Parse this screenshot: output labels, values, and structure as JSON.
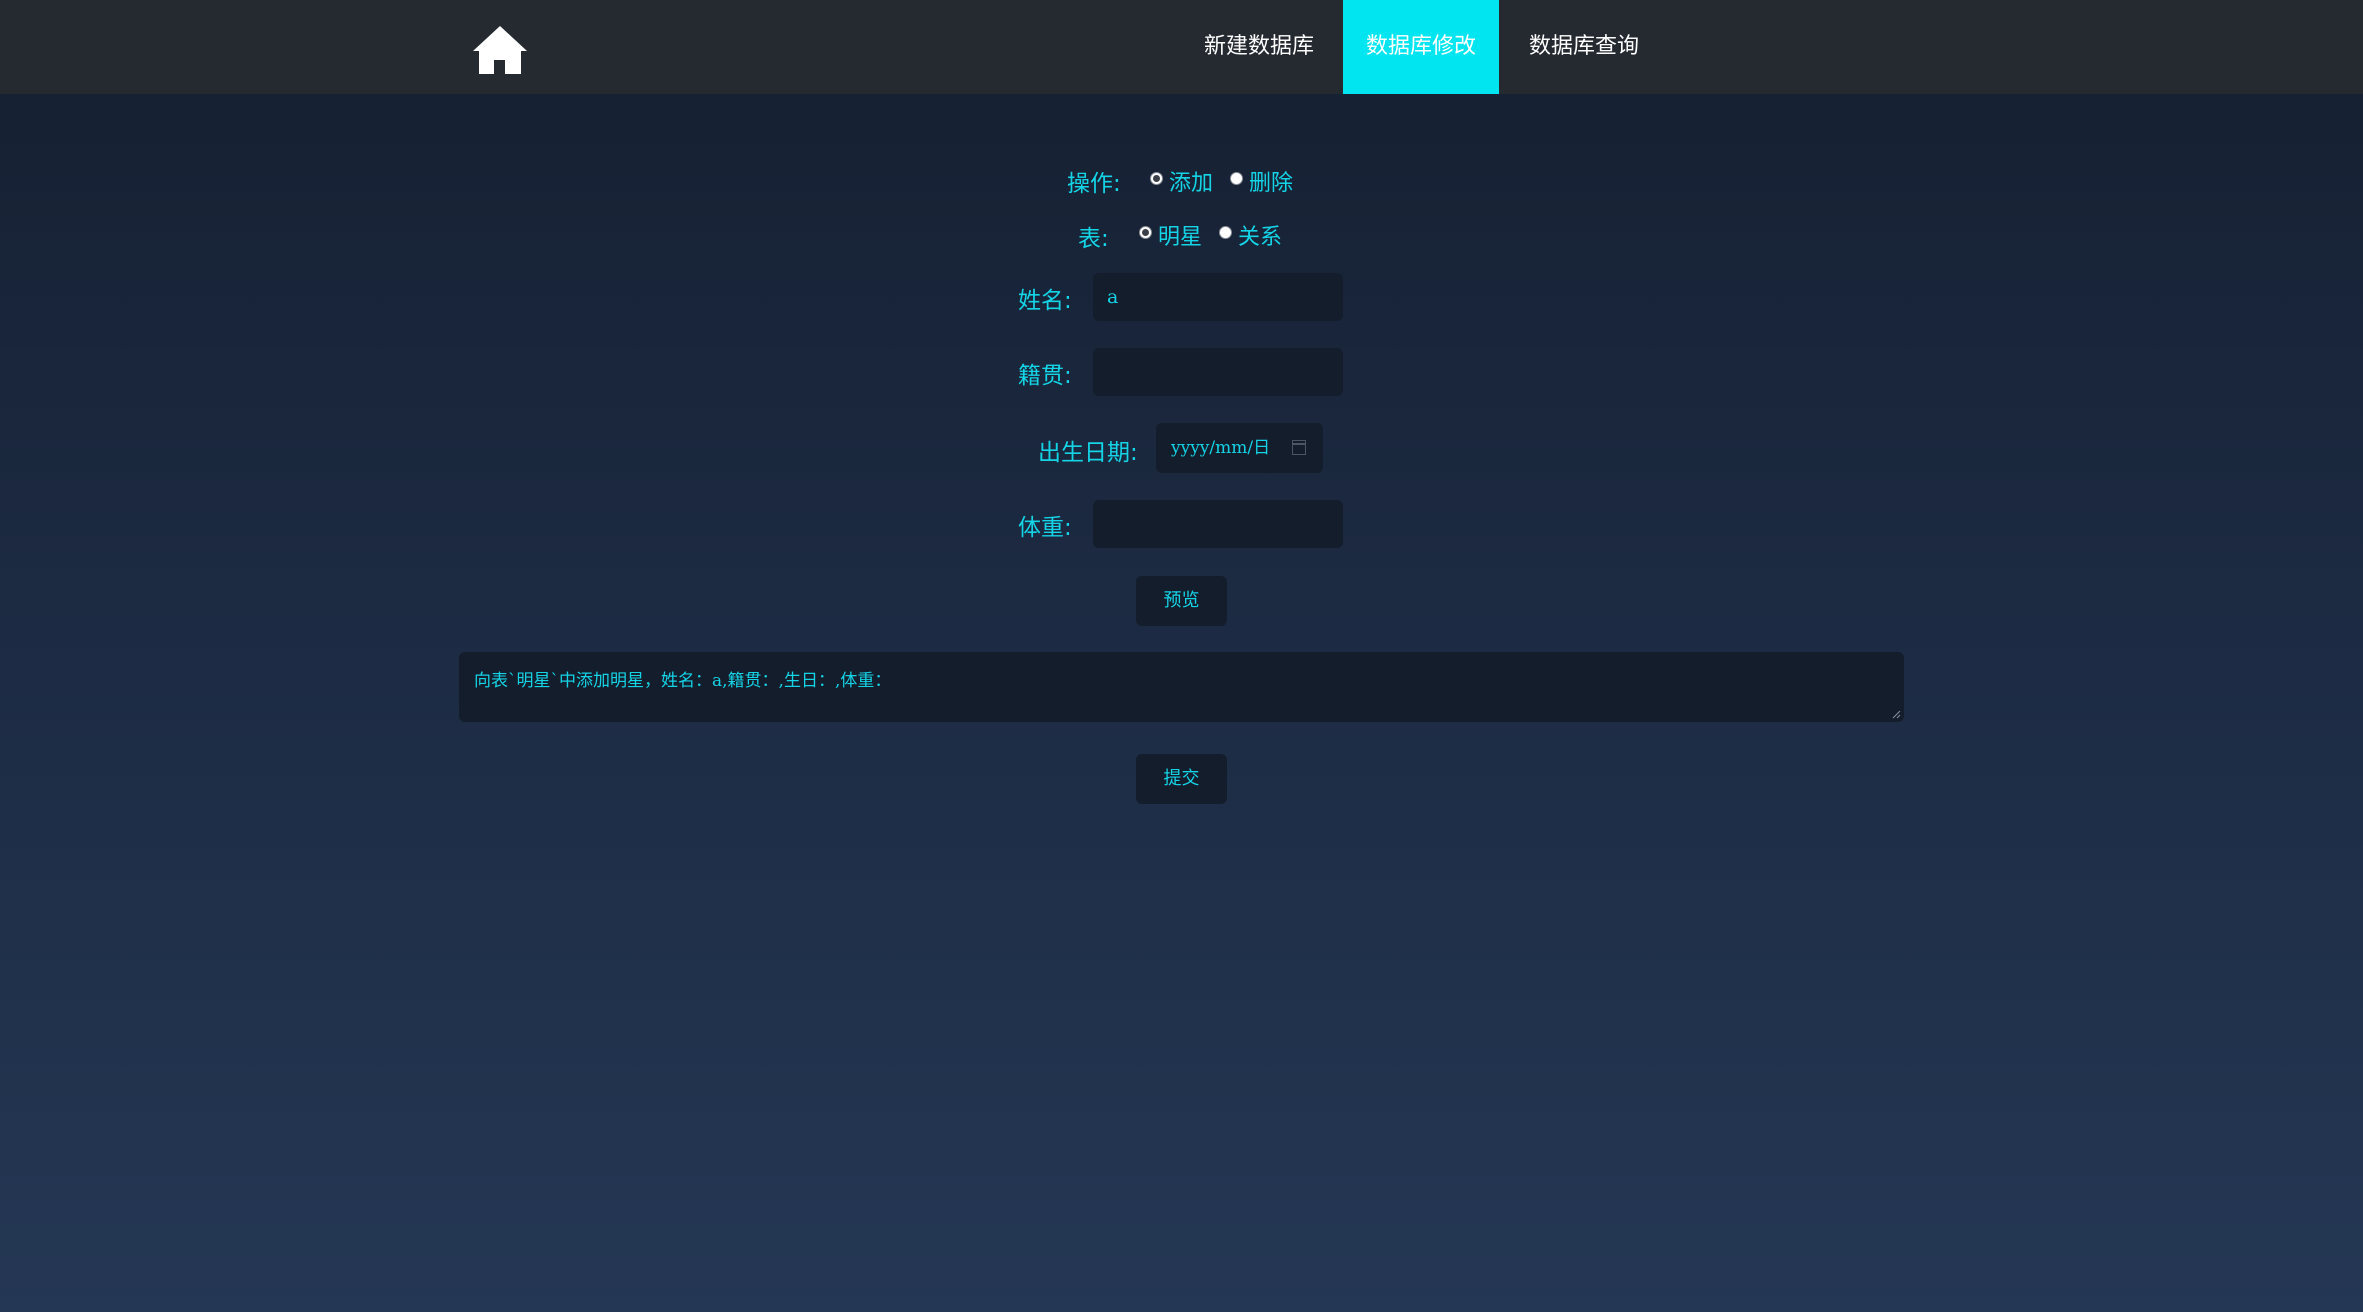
{
  "nav": {
    "home_icon": "home-icon",
    "items": [
      {
        "label": "新建数据库",
        "active": false
      },
      {
        "label": "数据库修改",
        "active": true
      },
      {
        "label": "数据库查询",
        "active": false
      }
    ],
    "active_color": "#00e5f0"
  },
  "form": {
    "operation": {
      "label": "操作:",
      "options": [
        {
          "label": "添加",
          "checked": true
        },
        {
          "label": "删除",
          "checked": false
        }
      ]
    },
    "table": {
      "label": "表:",
      "options": [
        {
          "label": "明星",
          "checked": true
        },
        {
          "label": "关系",
          "checked": false
        }
      ]
    },
    "name": {
      "label": "姓名:",
      "value": "a"
    },
    "hometown": {
      "label": "籍贯:",
      "value": ""
    },
    "birthdate": {
      "label": "出生日期:",
      "placeholder": "yyyy/mm/日",
      "icon": "calendar-icon"
    },
    "weight": {
      "label": "体重:",
      "value": ""
    },
    "preview_button": "预览",
    "preview_text": "向表`明星`中添加明星，姓名：a,籍贯：,生日：,体重：",
    "submit_button": "提交"
  },
  "colors": {
    "accent_text": "#14d4e6",
    "navbar_bg": "#252a31",
    "field_bg": "#141d2c"
  }
}
